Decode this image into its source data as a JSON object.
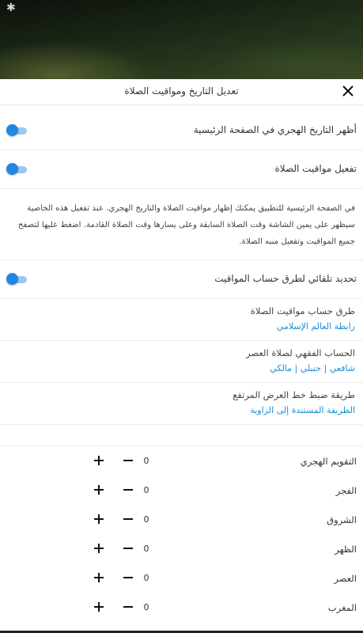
{
  "header": {
    "title": "تعديل التاريخ ومواقيت الصلاة",
    "moon_icon": "moon-icon",
    "close_icon": "close-icon"
  },
  "toggles": [
    {
      "label": "أظهر التاريخ الهجري في الصفحة الرئيسية",
      "enabled": true
    },
    {
      "label": "تفعيل مواقيت الصلاة",
      "enabled": true
    }
  ],
  "description": "في الصفحة الرئيسية للتطبيق يمكنك إظهار مواقيت الصلاة والتاريخ الهجري. عند تفعيل هذه الخاصية سيظهر على يمين الشاشة وقت الصلاة السابقة وعلى يسارها وقت الصلاة القادمة. اضغط عليها لتصفح جميع المواقيت وتفعيل منبه الصلاة.",
  "auto_toggle": {
    "label": "تحديد تلقائي لطرق حساب المواقيت",
    "enabled": true
  },
  "settings": [
    {
      "title": "طرق حساب مواقيت الصلاة",
      "value": "رابطة العالم الإسلامي"
    },
    {
      "title": "الحساب الفقهي لصلاة العصر",
      "value": "شافعي | حنبلي | مالكي"
    },
    {
      "title": "طريقة ضبط خط العرض المرتفع",
      "value": "الطريقة المستندة إلى الزاوية"
    }
  ],
  "adjustments": [
    {
      "label": "التقويم الهجري",
      "value": "0"
    },
    {
      "label": "الفجر",
      "value": "0"
    },
    {
      "label": "الشروق",
      "value": "0"
    },
    {
      "label": "الظهر",
      "value": "0"
    },
    {
      "label": "العصر",
      "value": "0"
    },
    {
      "label": "المغرب",
      "value": "0"
    }
  ],
  "colors": {
    "accent": "#1e88e5",
    "link": "#1a8fd4"
  }
}
